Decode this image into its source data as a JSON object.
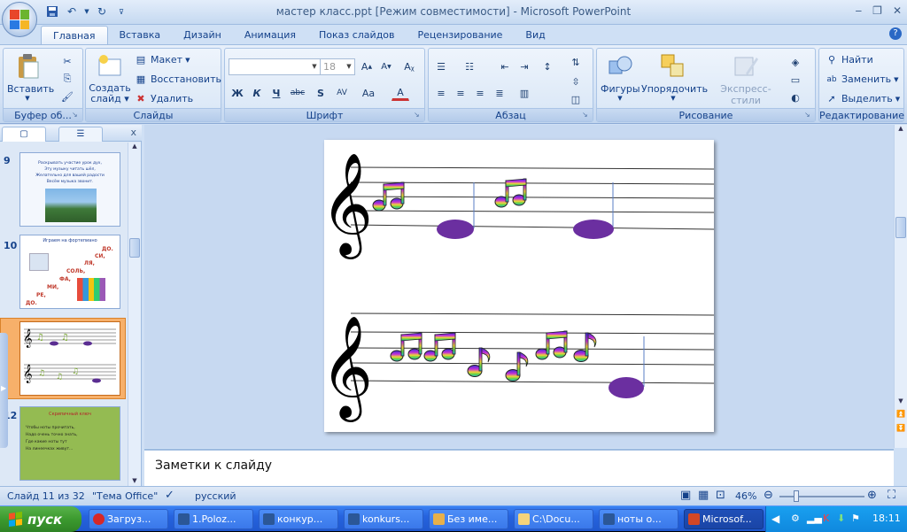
{
  "window": {
    "title": "мастер класс.ppt [Режим совместимости] - Microsoft PowerPoint",
    "minimize_icon": "minimize-icon",
    "restore_icon": "restore-icon",
    "close_icon": "close-icon"
  },
  "ribbon": {
    "tabs": [
      "Главная",
      "Вставка",
      "Дизайн",
      "Анимация",
      "Показ слайдов",
      "Рецензирование",
      "Вид"
    ],
    "groups": {
      "clipboard": {
        "label": "Буфер об...",
        "paste": "Вставить"
      },
      "slides": {
        "label": "Слайды",
        "new_slide": "Создать слайд",
        "layout": "Макет",
        "reset": "Восстановить",
        "delete": "Удалить"
      },
      "font": {
        "label": "Шрифт",
        "font_name": "",
        "font_size": "18"
      },
      "paragraph": {
        "label": "Абзац"
      },
      "drawing": {
        "label": "Рисование",
        "shapes": "Фигуры",
        "arrange": "Упорядочить",
        "quick_styles": "Экспресс-стили"
      },
      "editing": {
        "label": "Редактирование",
        "find": "Найти",
        "replace": "Заменить",
        "select": "Выделить"
      }
    }
  },
  "slides_panel": {
    "thumbnails": [
      {
        "number": "9",
        "lines": [
          "Раскрывать участие урок дух,",
          "Эту музыку читать шёл,",
          "Желательно для вашей радости",
          "Весём музыка звонит."
        ]
      },
      {
        "number": "10",
        "title": "Играем на фортепиано",
        "notes": [
          "ДО.",
          "СИ,",
          "ЛЯ,",
          "СОЛЬ,",
          "ФА,",
          "МИ,",
          "РЕ,",
          "ДО."
        ]
      },
      {
        "number": "11"
      },
      {
        "number": "12",
        "lines": [
          "Скрипичный ключ",
          "Чтобы ноты прочитать,",
          "Надо очень точно знать,",
          "Где какие ноты тут",
          "На линеечках живут..."
        ]
      }
    ]
  },
  "notes_placeholder": "Заметки к слайду",
  "status": {
    "slide_info": "Слайд 11 из 32",
    "theme": "\"Тема Office\"",
    "language": "русский",
    "zoom": "46%"
  },
  "taskbar": {
    "start": "пуск",
    "tasks": [
      "Загруз...",
      "1.Poloz...",
      "конкур...",
      "konkurs...",
      "Без име...",
      "C:\\Docu...",
      "ноты о...",
      "Microsof..."
    ],
    "clock": "18:11"
  },
  "colors": {
    "accent": "#cfe0f5",
    "oval": "#6b2fa0",
    "selected_thumb": "#f6a75a"
  }
}
